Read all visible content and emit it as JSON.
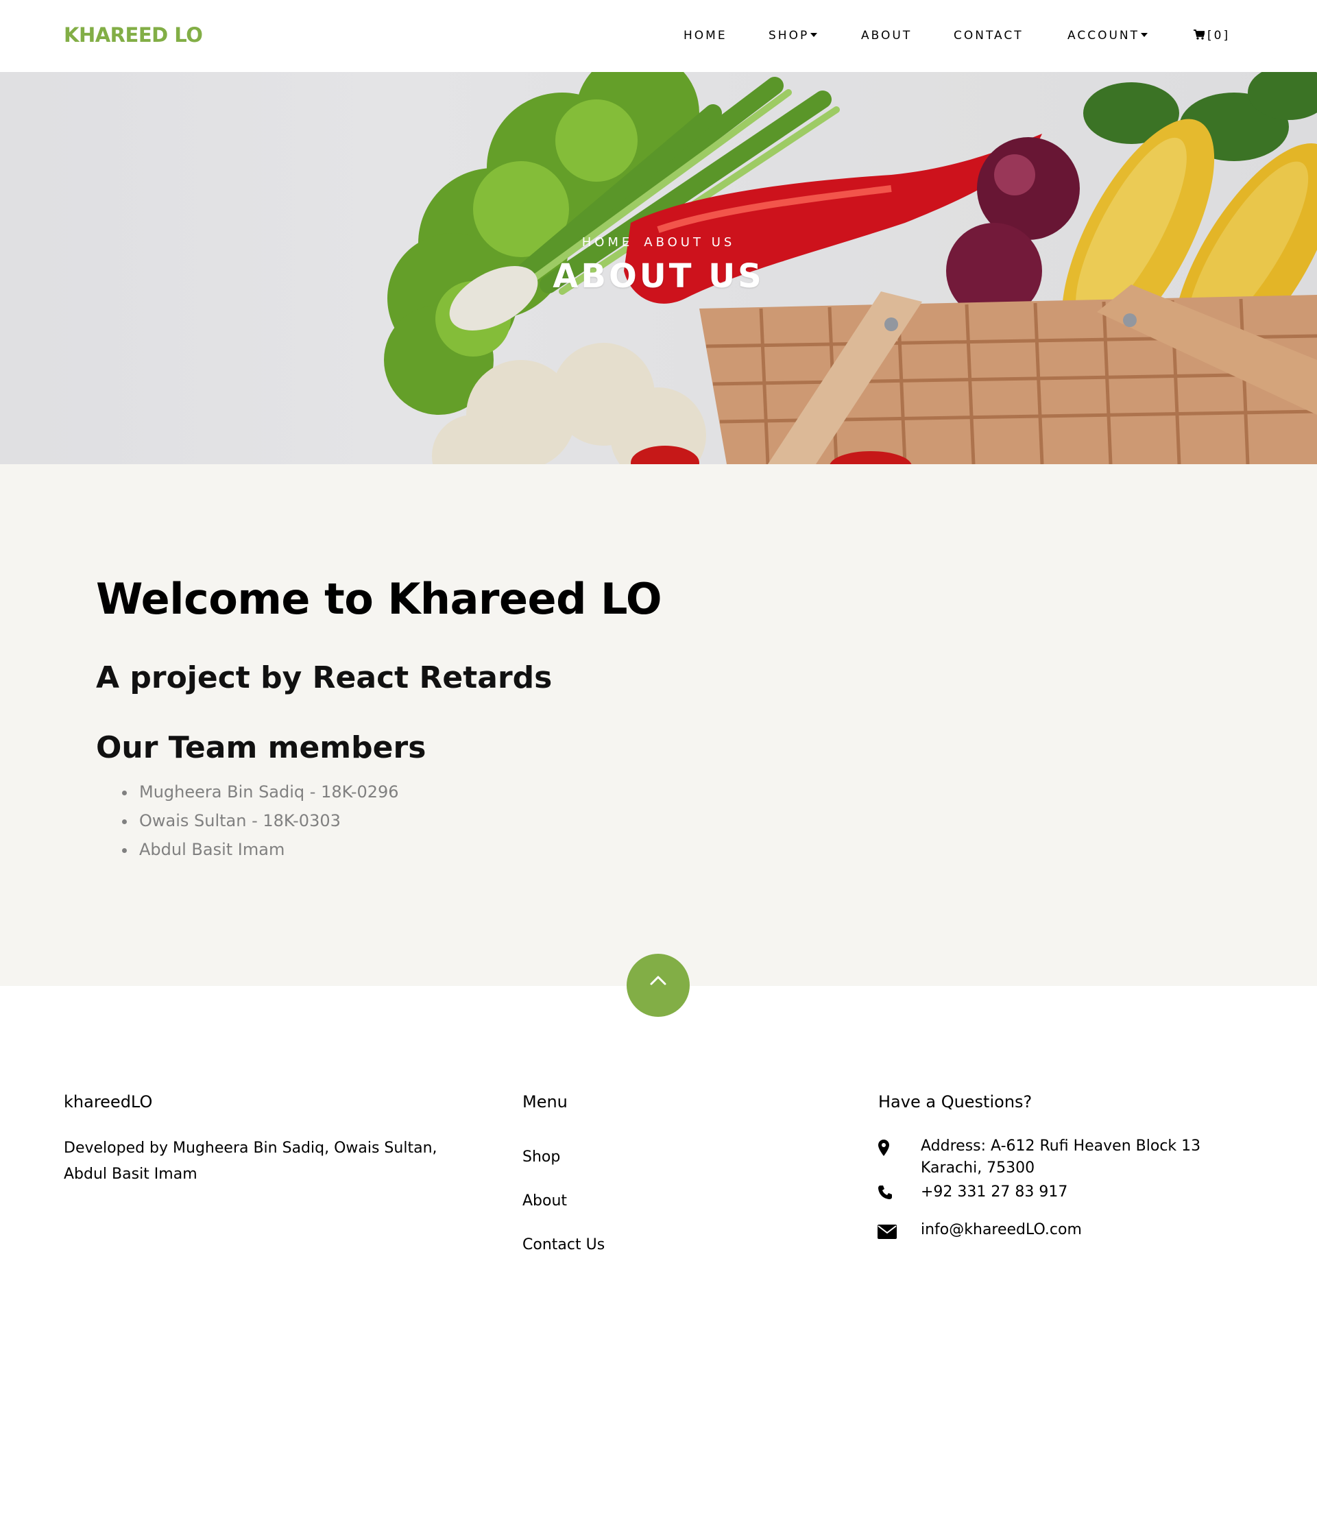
{
  "brand": "KHAREED LO",
  "nav": {
    "home": "HOME",
    "shop": "SHOP",
    "about": "ABOUT",
    "contact": "CONTACT",
    "account": "ACCOUNT",
    "cart": "[0]"
  },
  "hero": {
    "breadcrumb_home": "HOME",
    "breadcrumb_current": "ABOUT US",
    "title": "ABOUT US"
  },
  "about": {
    "welcome": "Welcome to Khareed LO",
    "project": "A project by React Retards",
    "team_title": "Our Team members",
    "members": [
      "Mugheera Bin Sadiq - 18K-0296",
      "Owais Sultan - 18K-0303",
      "Abdul Basit Imam"
    ]
  },
  "footer": {
    "col1_title": "khareedLO",
    "col1_text": "Developed by Mugheera Bin Sadiq, Owais Sultan, Abdul Basit Imam",
    "menu_title": "Menu",
    "menu": [
      "Shop",
      "About",
      "Contact Us"
    ],
    "contact_title": "Have a Questions?",
    "address": "Address: A-612 Rufi Heaven Block 13 Karachi, 75300",
    "phone": "+92 331 27 83 917",
    "email": "info@khareedLO.com"
  },
  "colors": {
    "accent": "#82ae46",
    "section_bg": "#f6f5f1",
    "muted_text": "#808080"
  },
  "icons": [
    "cart-icon",
    "caret-down-icon",
    "chevron-up-icon",
    "map-marker-icon",
    "phone-icon",
    "envelope-icon"
  ]
}
